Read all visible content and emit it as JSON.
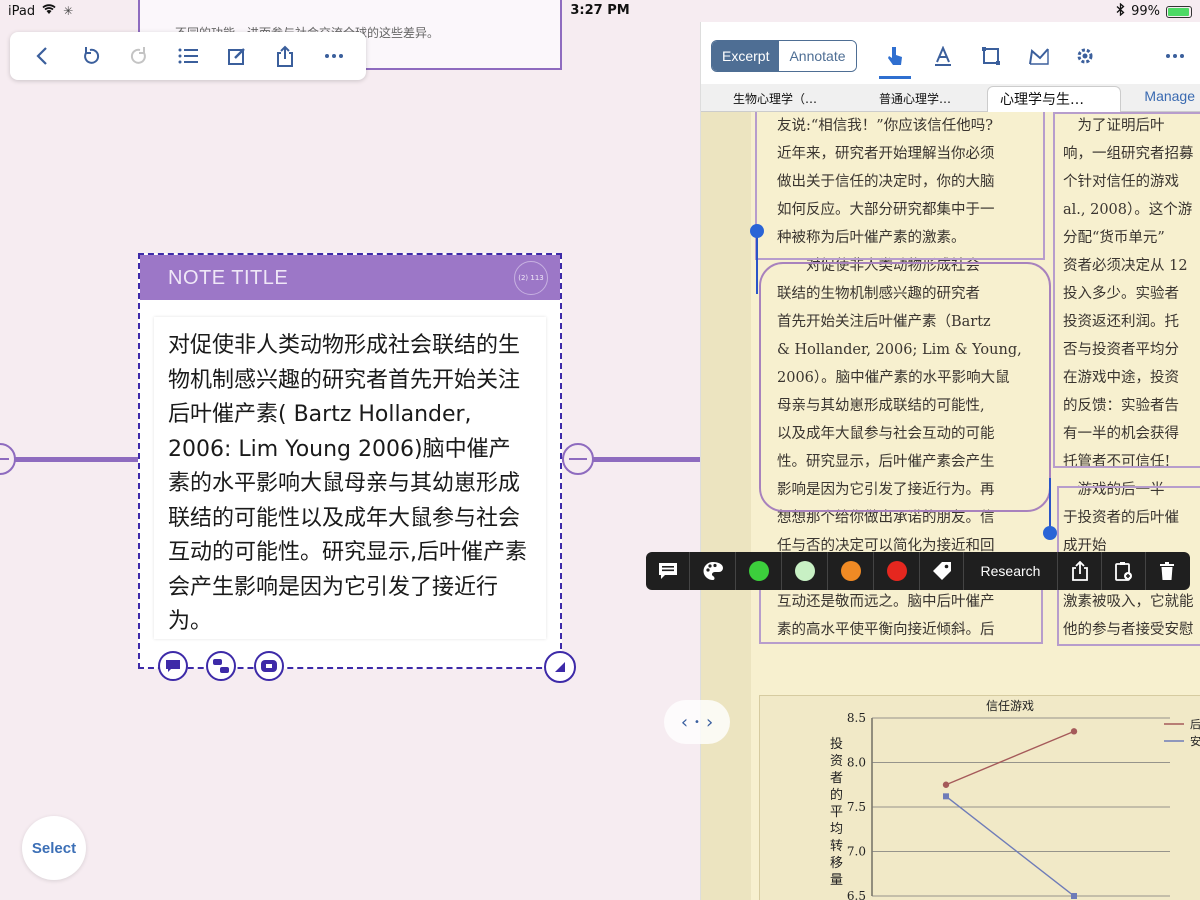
{
  "status_bar": {
    "device": "iPad",
    "time": "3:27 PM",
    "battery": "99%"
  },
  "top_note_fragment": "不同的功能，进而参与社会交流全球的这些差异。",
  "note": {
    "title": "NOTE TITLE",
    "badge": "(2) 113",
    "body": "对促使非人类动物形成社会联结的生物机制感兴趣的研究者首先开始关注后叶催产素( Bartz Hollander, 2006: Lim Young 2006)脑中催产素的水平影响大鼠母亲与其幼崽形成联结的可能性以及成年大鼠参与社会互动的可能性。研究显示,后叶催产素会产生影响是因为它引发了接近行为。"
  },
  "select_label": "Select",
  "pane": {
    "segments": {
      "excerpt": "Excerpt",
      "annotate": "Annotate"
    },
    "tabs": [
      "生物心理学（…",
      "普通心理学…",
      "心理学与生…"
    ],
    "manage": "Manage"
  },
  "doc": {
    "left_col": [
      "友说:“相信我！”你应该信任他吗?",
      "近年来，研究者开始理解当你必须",
      "做出关于信任的决定时，你的大脑",
      "如何反应。大部分研究都集中于一",
      "种被称为后叶催产素的激素。",
      "　　对促使非人类动物形成社会",
      "联结的生物机制感兴趣的研究者",
      "首先开始关注后叶催产素（Bartz",
      "& Hollander, 2006; Lim & Young,",
      "2006）。脑中催产素的水平影响大鼠",
      "母亲与其幼崽形成联结的可能性,",
      "以及成年大鼠参与社会互动的可能",
      "性。研究显示，后叶催产素会产生",
      "影响是因为它引发了接近行为。再",
      "想想那个给你做出承诺的朋友。信",
      "任与否的决定可以简化为接近和回",
      "",
      "互动还是敬而远之。脑中后叶催产",
      "素的高水平使平衡向接近倾斜。后"
    ],
    "right_col": [
      "　为了证明后叶",
      "响，一组研究者招募",
      "个针对信任的游戏",
      "al., 2008）。这个游",
      "分配“货币单元”",
      "资者必须决定从 12",
      "投入多少。实验者",
      "投资返还利润。托",
      "否与投资者平均分",
      "在游戏中途，投资",
      "的反馈：实验者告",
      "有一半的机会获得",
      "托管者不可信任!",
      "　游戏的后一半",
      "于投资者的后叶催",
      "成开始",
      "",
      "激素被吸入，它就能",
      "他的参与者接受安慰"
    ]
  },
  "actionbar": {
    "research": "Research",
    "colors": [
      "#3ccf3c",
      "#c8f0c4",
      "#f08a24",
      "#e5271f"
    ]
  },
  "chart_data": {
    "type": "line",
    "title": "信任游戏",
    "ylabel": "投资者的平均转移量",
    "ylim": [
      6.5,
      8.5
    ],
    "yticks": [
      "8.5",
      "8.0",
      "7.5",
      "7.0",
      "6.5"
    ],
    "series": [
      {
        "name": "后",
        "color": "#a55a5a",
        "values": [
          7.75,
          8.35
        ]
      },
      {
        "name": "安",
        "color": "#6f7cb8",
        "values": [
          7.62,
          6.5
        ]
      }
    ]
  }
}
